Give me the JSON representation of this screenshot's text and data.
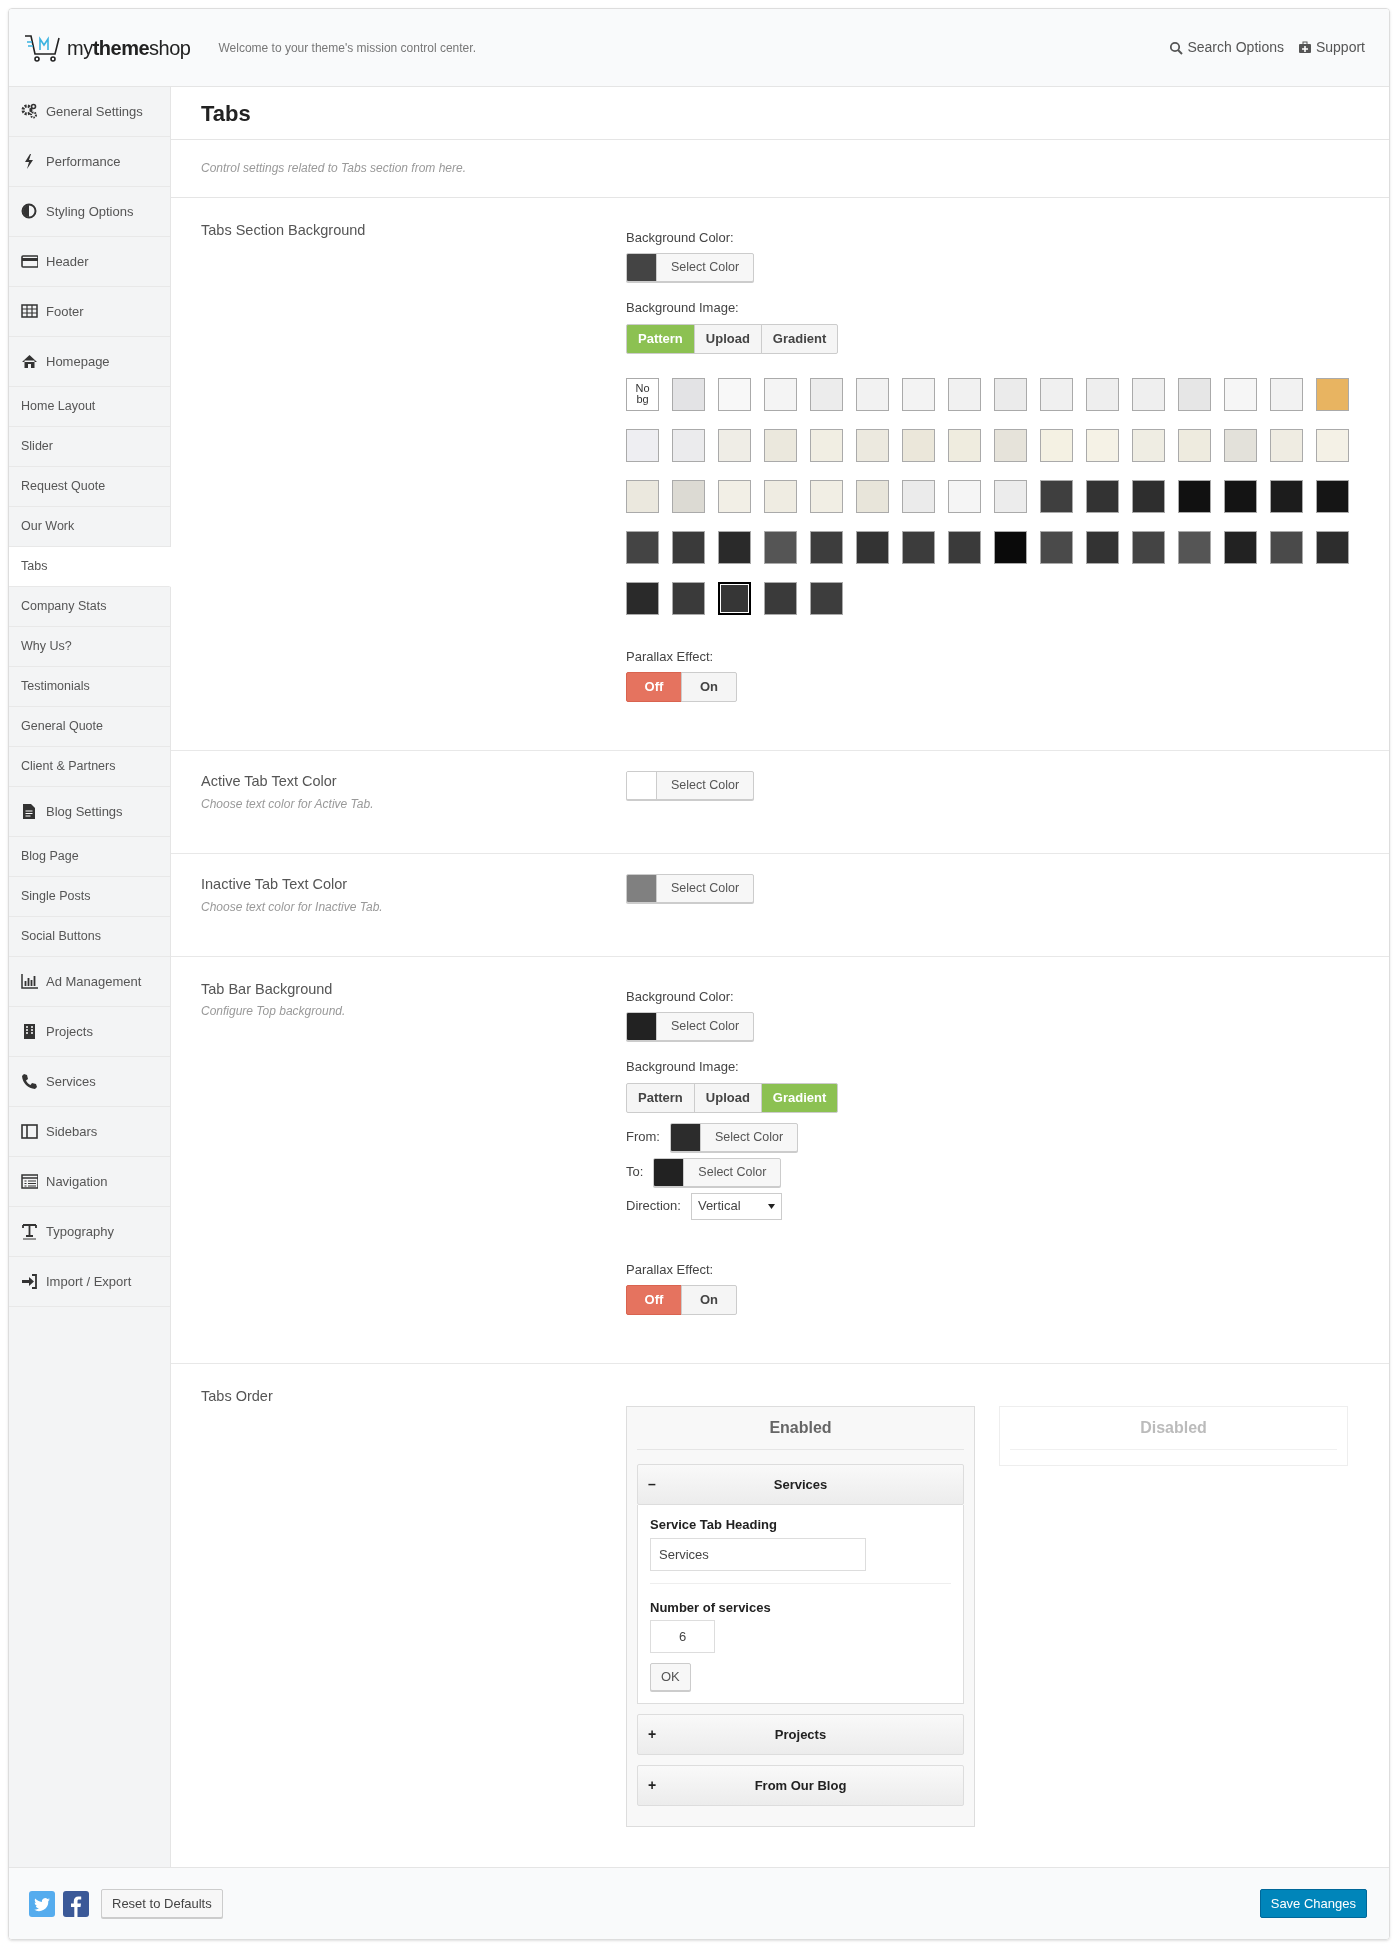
{
  "header": {
    "logo": "my**theme**shop",
    "tagline": "Welcome to your theme's mission control center.",
    "links": [
      {
        "label": "Search Options"
      },
      {
        "label": "Support"
      }
    ]
  },
  "sidebar": {
    "items": [
      {
        "label": "General Settings",
        "kind": "group",
        "selected": false
      },
      {
        "label": "Performance",
        "kind": "group",
        "selected": false
      },
      {
        "label": "Styling Options",
        "kind": "group",
        "selected": false
      },
      {
        "label": "Header",
        "kind": "group",
        "selected": false
      },
      {
        "label": "Footer",
        "kind": "group",
        "selected": false
      },
      {
        "label": "Homepage",
        "kind": "group",
        "selected": false
      },
      {
        "label": "Home Layout",
        "kind": "sub",
        "selected": false
      },
      {
        "label": "Slider",
        "kind": "sub",
        "selected": false
      },
      {
        "label": "Request Quote",
        "kind": "sub",
        "selected": false
      },
      {
        "label": "Our Work",
        "kind": "sub",
        "selected": false
      },
      {
        "label": "Tabs",
        "kind": "sub",
        "selected": true
      },
      {
        "label": "Company Stats",
        "kind": "sub",
        "selected": false
      },
      {
        "label": "Why Us?",
        "kind": "sub",
        "selected": false
      },
      {
        "label": "Testimonials",
        "kind": "sub",
        "selected": false
      },
      {
        "label": "General Quote",
        "kind": "sub",
        "selected": false
      },
      {
        "label": "Client & Partners",
        "kind": "sub",
        "selected": false
      },
      {
        "label": "Blog Settings",
        "kind": "group",
        "selected": false
      },
      {
        "label": "Blog Page",
        "kind": "sub",
        "selected": false
      },
      {
        "label": "Single Posts",
        "kind": "sub",
        "selected": false
      },
      {
        "label": "Social Buttons",
        "kind": "sub",
        "selected": false
      },
      {
        "label": "Ad Management",
        "kind": "group",
        "selected": false
      },
      {
        "label": "Projects",
        "kind": "group",
        "selected": false
      },
      {
        "label": "Services",
        "kind": "group",
        "selected": false
      },
      {
        "label": "Sidebars",
        "kind": "group",
        "selected": false
      },
      {
        "label": "Navigation",
        "kind": "group",
        "selected": false
      },
      {
        "label": "Typography",
        "kind": "group",
        "selected": false
      },
      {
        "label": "Import / Export",
        "kind": "group",
        "selected": false
      }
    ]
  },
  "page": {
    "title": "Tabs",
    "description": "Control settings related to Tabs section from here."
  },
  "sections": [
    {
      "kind": "background",
      "label": "Tabs Section Background",
      "color_label": "Background Color:",
      "color": "#444444",
      "color_button": "Select Color",
      "image_label": "Background Image:",
      "image_tabs": [
        {
          "label": "Pattern",
          "selected": true
        },
        {
          "label": "Upload",
          "selected": false
        },
        {
          "label": "Gradient",
          "selected": false
        }
      ],
      "patterns": [
        {
          "kind": "none",
          "label": "No bg",
          "selected": false
        },
        {
          "kind": "swatch",
          "color": "#e3e3e5",
          "selected": false
        },
        {
          "kind": "swatch",
          "color": "#f8f8f8",
          "selected": false
        },
        {
          "kind": "swatch",
          "color": "#f4f4f4",
          "selected": false
        },
        {
          "kind": "swatch",
          "color": "#ececec",
          "selected": false
        },
        {
          "kind": "swatch",
          "color": "#f2f2f2",
          "selected": false
        },
        {
          "kind": "swatch",
          "color": "#f3f3f3",
          "selected": false
        },
        {
          "kind": "swatch",
          "color": "#f1f1f1",
          "selected": false
        },
        {
          "kind": "swatch",
          "color": "#ebebeb",
          "selected": false
        },
        {
          "kind": "swatch",
          "color": "#f0f0f0",
          "selected": false
        },
        {
          "kind": "swatch",
          "color": "#eeeeee",
          "selected": false
        },
        {
          "kind": "swatch",
          "color": "#efefef",
          "selected": false
        },
        {
          "kind": "swatch",
          "color": "#e6e6e6",
          "selected": false
        },
        {
          "kind": "swatch",
          "color": "#f6f6f6",
          "selected": false
        },
        {
          "kind": "swatch",
          "color": "#f2f2f2",
          "selected": false
        },
        {
          "kind": "swatch",
          "color": "#e8b461",
          "selected": false
        },
        {
          "kind": "swatch",
          "color": "#eeeef2",
          "selected": false
        },
        {
          "kind": "swatch",
          "color": "#ebebed",
          "selected": false
        },
        {
          "kind": "swatch",
          "color": "#efede6",
          "selected": false
        },
        {
          "kind": "swatch",
          "color": "#ebe8dd",
          "selected": false
        },
        {
          "kind": "swatch",
          "color": "#f1eee3",
          "selected": false
        },
        {
          "kind": "swatch",
          "color": "#ece9df",
          "selected": false
        },
        {
          "kind": "swatch",
          "color": "#ebe7da",
          "selected": false
        },
        {
          "kind": "swatch",
          "color": "#efecdf",
          "selected": false
        },
        {
          "kind": "swatch",
          "color": "#e6e3da",
          "selected": false
        },
        {
          "kind": "swatch",
          "color": "#f4f1e3",
          "selected": false
        },
        {
          "kind": "swatch",
          "color": "#f5f2e6",
          "selected": false
        },
        {
          "kind": "swatch",
          "color": "#efede3",
          "selected": false
        },
        {
          "kind": "swatch",
          "color": "#eeebdf",
          "selected": false
        },
        {
          "kind": "swatch",
          "color": "#e3e1da",
          "selected": false
        },
        {
          "kind": "swatch",
          "color": "#efece2",
          "selected": false
        },
        {
          "kind": "swatch",
          "color": "#f4f1e6",
          "selected": false
        },
        {
          "kind": "swatch",
          "color": "#ebe8de",
          "selected": false
        },
        {
          "kind": "swatch",
          "color": "#dcdad3",
          "selected": false
        },
        {
          "kind": "swatch",
          "color": "#f2efe6",
          "selected": false
        },
        {
          "kind": "swatch",
          "color": "#efece2",
          "selected": false
        },
        {
          "kind": "swatch",
          "color": "#f1eee4",
          "selected": false
        },
        {
          "kind": "swatch",
          "color": "#e8e5da",
          "selected": false
        },
        {
          "kind": "swatch",
          "color": "#ebebeb",
          "selected": false
        },
        {
          "kind": "swatch",
          "color": "#f5f5f5",
          "selected": false
        },
        {
          "kind": "swatch",
          "color": "#ececec",
          "selected": false
        },
        {
          "kind": "swatch",
          "color": "#3f3f3f",
          "selected": false
        },
        {
          "kind": "swatch",
          "color": "#333333",
          "selected": false
        },
        {
          "kind": "swatch",
          "color": "#2e2e2e",
          "selected": false
        },
        {
          "kind": "swatch",
          "color": "#111111",
          "selected": false
        },
        {
          "kind": "swatch",
          "color": "#141414",
          "selected": false
        },
        {
          "kind": "swatch",
          "color": "#1c1c1c",
          "selected": false
        },
        {
          "kind": "swatch",
          "color": "#151515",
          "selected": false
        },
        {
          "kind": "swatch",
          "color": "#444444",
          "selected": false
        },
        {
          "kind": "swatch",
          "color": "#3a3a3a",
          "selected": false
        },
        {
          "kind": "swatch",
          "color": "#2a2a2a",
          "selected": false
        },
        {
          "kind": "swatch",
          "color": "#555555",
          "selected": false
        },
        {
          "kind": "swatch",
          "color": "#3d3d3d",
          "selected": false
        },
        {
          "kind": "swatch",
          "color": "#333333",
          "selected": false
        },
        {
          "kind": "swatch",
          "color": "#3c3c3c",
          "selected": false
        },
        {
          "kind": "swatch",
          "color": "#3a3a3a",
          "selected": false
        },
        {
          "kind": "swatch",
          "color": "#0a0a0a",
          "selected": false
        },
        {
          "kind": "swatch",
          "color": "#4a4a4a",
          "selected": false
        },
        {
          "kind": "swatch",
          "color": "#333333",
          "selected": false
        },
        {
          "kind": "swatch",
          "color": "#444444",
          "selected": false
        },
        {
          "kind": "swatch",
          "color": "#555555",
          "selected": false
        },
        {
          "kind": "swatch",
          "color": "#222222",
          "selected": false
        },
        {
          "kind": "swatch",
          "color": "#4a4a4a",
          "selected": false
        },
        {
          "kind": "swatch",
          "color": "#2d2d2d",
          "selected": false
        },
        {
          "kind": "swatch",
          "color": "#2a2a2a",
          "selected": false
        },
        {
          "kind": "swatch",
          "color": "#3a3a3a",
          "selected": false
        },
        {
          "kind": "swatch",
          "color": "#363636",
          "selected": true
        },
        {
          "kind": "swatch",
          "color": "#3a3a3a",
          "selected": false
        },
        {
          "kind": "swatch",
          "color": "#3d3d3d",
          "selected": false
        }
      ],
      "parallax_label": "Parallax Effect:",
      "parallax": [
        {
          "label": "Off",
          "selected": true
        },
        {
          "label": "On",
          "selected": false
        }
      ]
    },
    {
      "kind": "color",
      "label": "Active Tab Text Color",
      "hint": "Choose text color for Active Tab.",
      "color": "#ffffff",
      "color_button": "Select Color"
    },
    {
      "kind": "color",
      "label": "Inactive Tab Text Color",
      "hint": "Choose text color for Inactive Tab.",
      "color": "#808080",
      "color_button": "Select Color"
    },
    {
      "kind": "background",
      "label": "Tab Bar Background",
      "hint": "Configure Top background.",
      "color_label": "Background Color:",
      "color": "#222222",
      "color_button": "Select Color",
      "image_label": "Background Image:",
      "image_tabs": [
        {
          "label": "Pattern",
          "selected": false
        },
        {
          "label": "Upload",
          "selected": false
        },
        {
          "label": "Gradient",
          "selected": true
        }
      ],
      "gradient": {
        "from": {
          "label": "From:",
          "color": "#2c2c2c",
          "button": "Select Color"
        },
        "to": {
          "label": "To:",
          "color": "#222222",
          "button": "Select Color"
        },
        "direction_label": "Direction:",
        "direction": "Vertical"
      },
      "parallax_label": "Parallax Effect:",
      "parallax": [
        {
          "label": "Off",
          "selected": true
        },
        {
          "label": "On",
          "selected": false
        }
      ]
    },
    {
      "kind": "order",
      "label": "Tabs Order",
      "enabled_title": "Enabled",
      "disabled_title": "Disabled",
      "items": [
        {
          "title": "Services",
          "toggle": "–",
          "expanded": true,
          "fields": [
            {
              "label": "Service Tab Heading",
              "value": "Services",
              "kind": "text"
            },
            {
              "label": "Number of services",
              "value": "6",
              "kind": "number"
            }
          ],
          "ok_button": "OK"
        },
        {
          "title": "Projects",
          "toggle": "+",
          "expanded": false
        },
        {
          "title": "From Our Blog",
          "toggle": "+",
          "expanded": false
        }
      ]
    }
  ],
  "footer": {
    "reset_button": "Reset to Defaults",
    "save_button": "Save Changes"
  }
}
